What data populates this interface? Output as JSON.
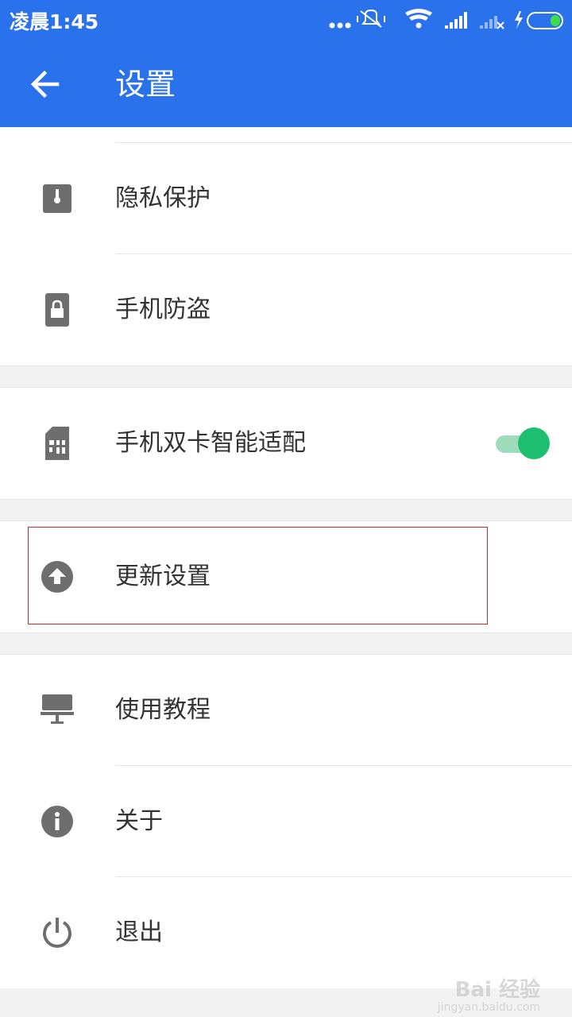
{
  "status_bar": {
    "time": "凌晨1:45",
    "icons": [
      "more-dots-icon",
      "mute-vibrate-icon",
      "wifi-icon",
      "signal-icon",
      "signal-no-sim-icon",
      "charging-icon",
      "battery-icon"
    ]
  },
  "header": {
    "title": "设置",
    "back_icon": "arrow-left-icon",
    "background": "#2a72ec"
  },
  "items": {
    "privacy": {
      "label": "隐私保护",
      "icon": "privacy-lock-icon"
    },
    "anti_theft": {
      "label": "手机防盗",
      "icon": "phone-lock-icon"
    },
    "dual_sim": {
      "label": "手机双卡智能适配",
      "icon": "sim-card-icon",
      "toggle_on": true
    },
    "update": {
      "label": "更新设置",
      "icon": "upload-circle-icon"
    },
    "tutorial": {
      "label": "使用教程",
      "icon": "monitor-icon"
    },
    "about": {
      "label": "关于",
      "icon": "info-icon"
    },
    "exit": {
      "label": "退出",
      "icon": "power-icon"
    }
  },
  "watermark": {
    "text": "Bai 经验",
    "sub": "jingyan.baidu.com"
  },
  "colors": {
    "accent": "#2a72ec",
    "toggle_on": "#1bbf6d",
    "highlight": "#d9252a",
    "icon_gray": "#6e6e6e"
  }
}
